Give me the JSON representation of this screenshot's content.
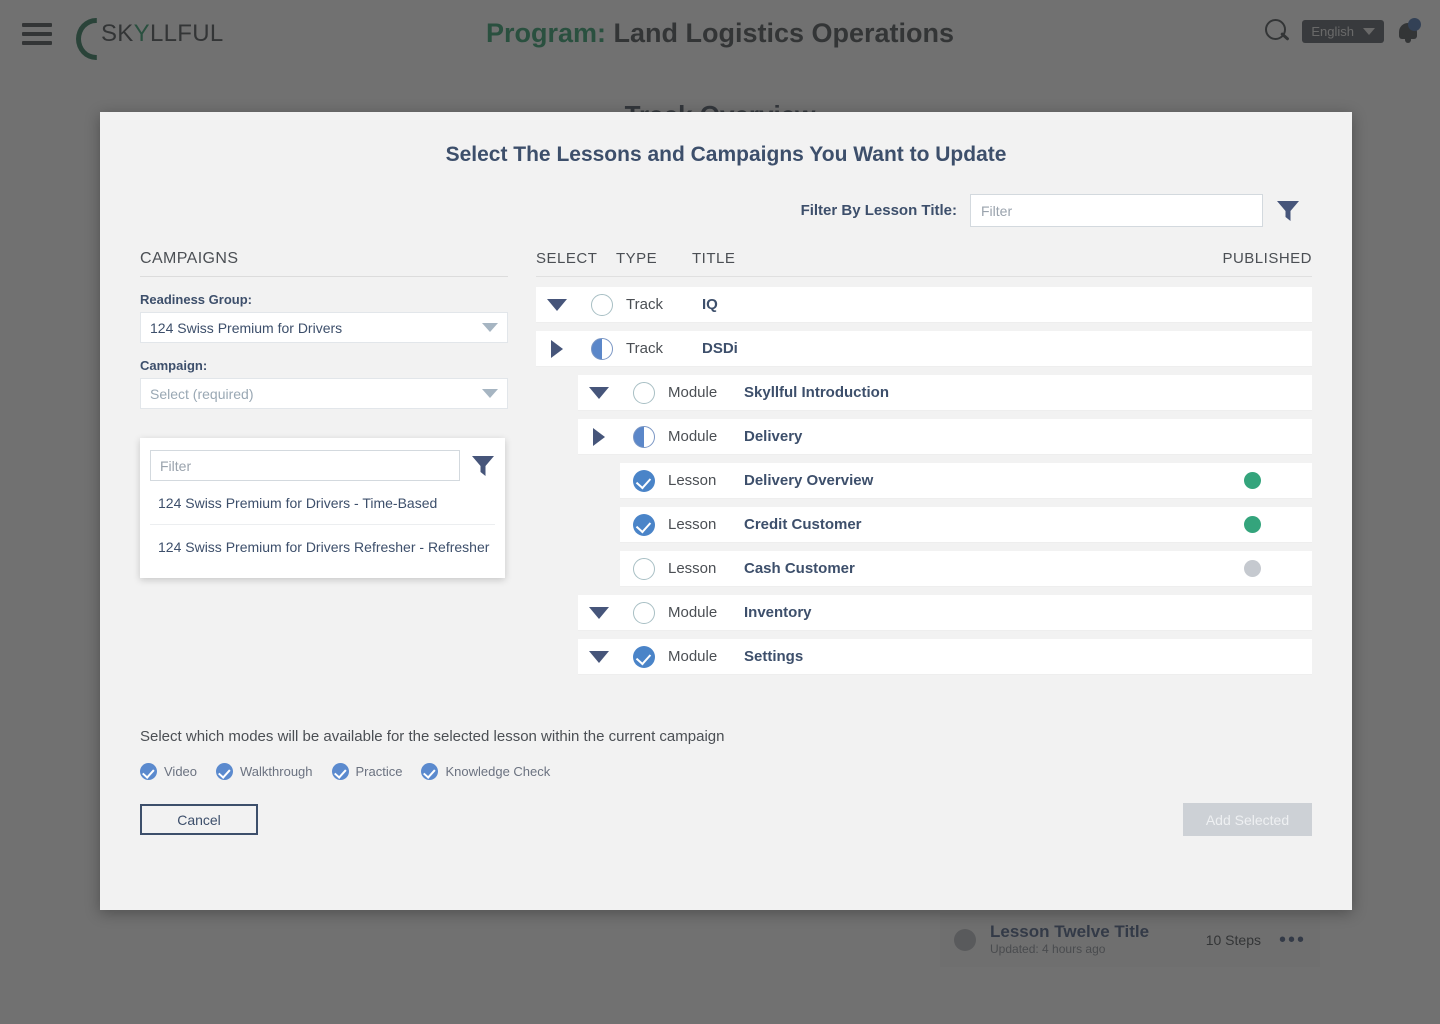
{
  "header": {
    "menu_icon": "hamburger-icon",
    "logo_text": "SKYLLFUL",
    "logo_prefix": "SK",
    "logo_y": "Y",
    "logo_suffix": "LLFUL",
    "program_prefix": "Program:",
    "program_name": "Land Logistics Operations",
    "search_icon": "search-icon",
    "language": "English",
    "bell_icon": "bell-icon"
  },
  "background": {
    "subtitle": "Track Overview",
    "card": {
      "title": "Lesson Twelve Title",
      "subtitle": "Updated: 4 hours ago",
      "steps": "10 Steps",
      "more": "•••"
    }
  },
  "modal": {
    "title": "Select The Lessons and Campaigns You Want to Update",
    "filter": {
      "label": "Filter By Lesson Title:",
      "value": "",
      "placeholder": "Filter",
      "funnel_icon": "funnel-icon"
    },
    "campaigns": {
      "heading": "CAMPAIGNS",
      "readiness_group_label": "Readiness Group:",
      "readiness_group_value": "124 Swiss Premium for Drivers",
      "campaign_label": "Campaign:",
      "campaign_value": "Select (required)",
      "dropdown": {
        "filter_value": "",
        "filter_placeholder": "Filter",
        "funnel_icon": "funnel-icon",
        "options": [
          "124 Swiss Premium for Drivers - Time-Based",
          "124 Swiss Premium for Drivers Refresher - Refresher"
        ]
      }
    },
    "tree": {
      "columns": {
        "select": "SELECT",
        "type": "TYPE",
        "title": "TITLE",
        "published": "PUBLISHED"
      },
      "rows": [
        {
          "level": 0,
          "toggle": "down",
          "check": "empty",
          "type": "Track",
          "title": "IQ",
          "published": ""
        },
        {
          "level": 0,
          "toggle": "right",
          "check": "half",
          "type": "Track",
          "title": "DSDi",
          "published": ""
        },
        {
          "level": 1,
          "toggle": "down",
          "check": "empty",
          "type": "Module",
          "title": "Skyllful Introduction",
          "published": ""
        },
        {
          "level": 1,
          "toggle": "right",
          "check": "half",
          "type": "Module",
          "title": "Delivery",
          "published": ""
        },
        {
          "level": 2,
          "toggle": "none",
          "check": "full",
          "type": "Lesson",
          "title": "Delivery Overview",
          "published": "green"
        },
        {
          "level": 2,
          "toggle": "none",
          "check": "full",
          "type": "Lesson",
          "title": "Credit Customer",
          "published": "green"
        },
        {
          "level": 2,
          "toggle": "none",
          "check": "empty",
          "type": "Lesson",
          "title": "Cash Customer",
          "published": "gray"
        },
        {
          "level": 1,
          "toggle": "down",
          "check": "empty",
          "type": "Module",
          "title": "Inventory",
          "published": ""
        },
        {
          "level": 1,
          "toggle": "down",
          "check": "full",
          "type": "Module",
          "title": "Settings",
          "published": ""
        }
      ]
    },
    "modes": {
      "description": "Select which modes will be available for the selected lesson within the current campaign",
      "items": [
        {
          "label": "Video",
          "checked": true
        },
        {
          "label": "Walkthrough",
          "checked": true
        },
        {
          "label": "Practice",
          "checked": true
        },
        {
          "label": "Knowledge Check",
          "checked": true
        }
      ]
    },
    "footer": {
      "cancel_label": "Cancel",
      "add_label": "Add Selected"
    }
  },
  "colors": {
    "brand_green": "#2f9e6e",
    "accent_blue": "#4a84c8",
    "published_green": "#34a47c",
    "published_gray": "#c5c9cf",
    "title_navy": "#3d4f6b"
  }
}
